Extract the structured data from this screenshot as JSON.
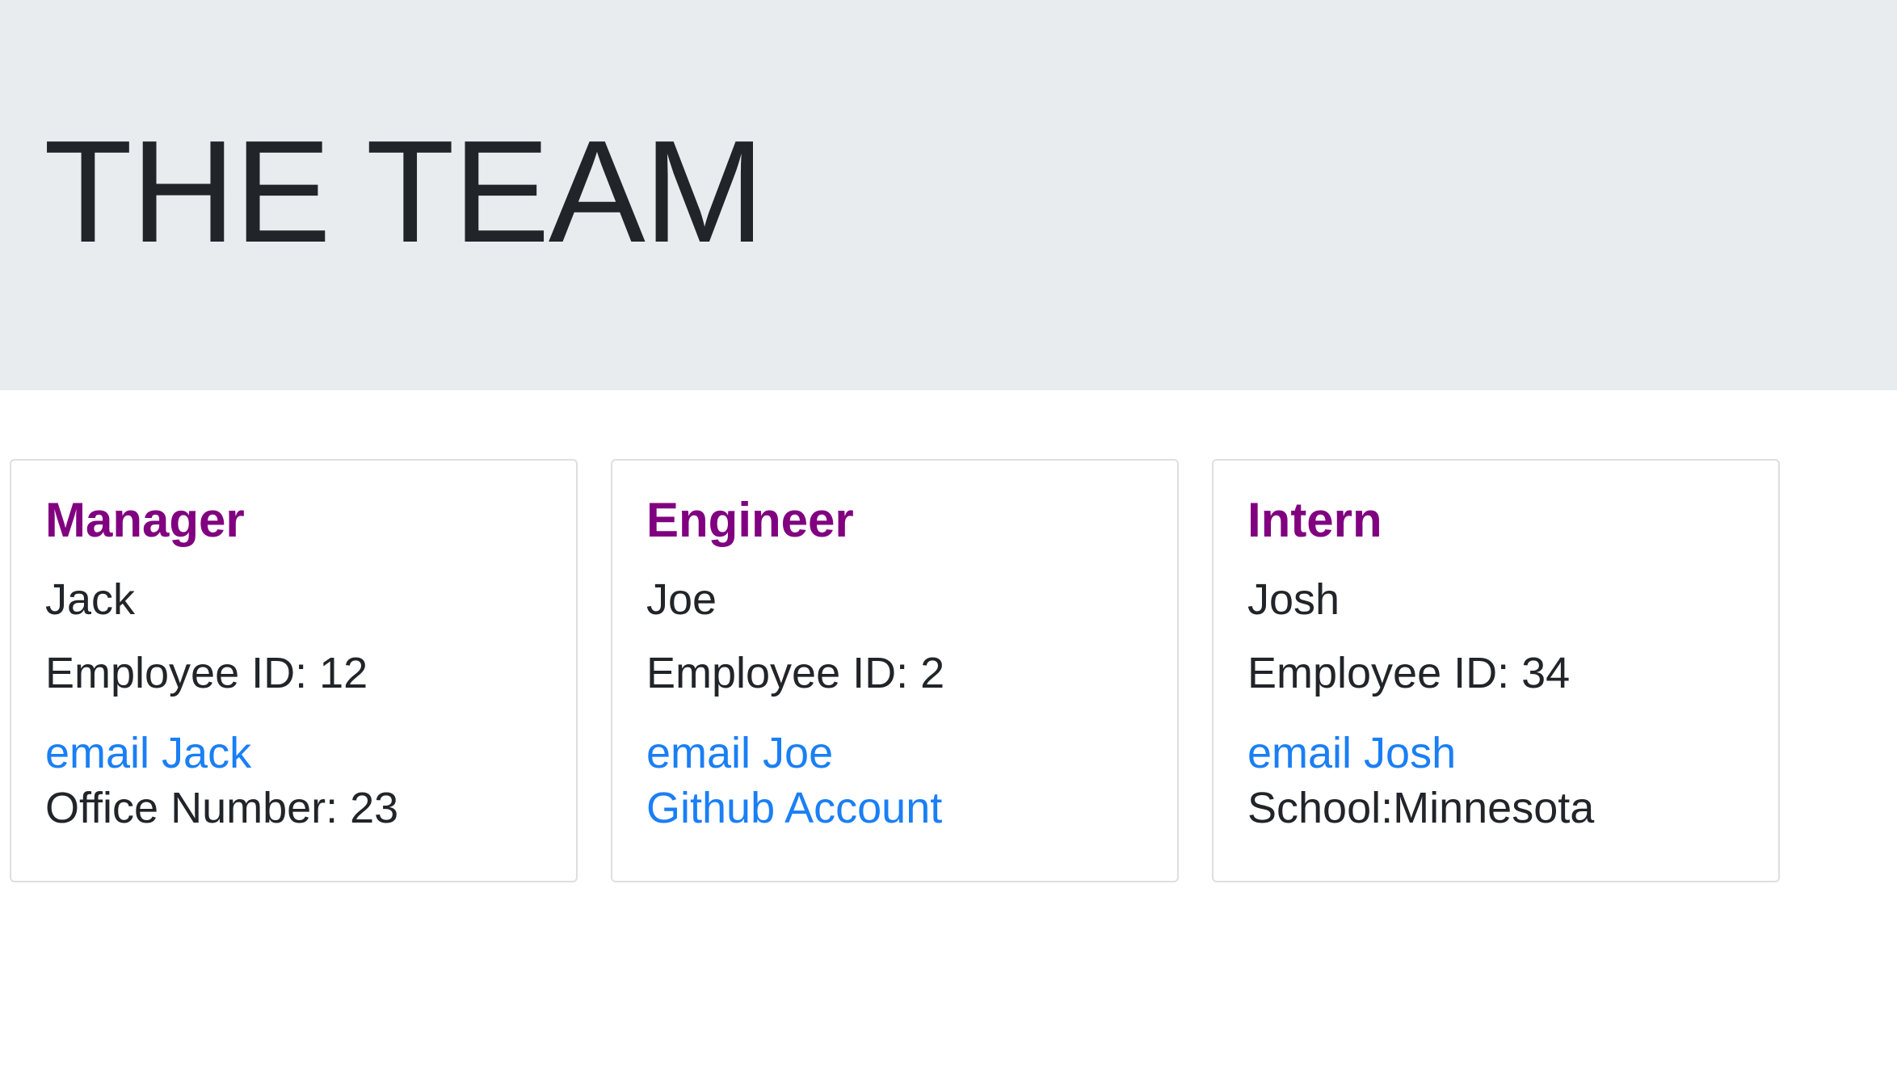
{
  "header": {
    "title": "THE TEAM"
  },
  "colors": {
    "header_bg": "#e9ecef",
    "role_color": "#800080",
    "link_color": "#1a7ff5",
    "text_color": "#212529"
  },
  "team": [
    {
      "role": "Manager",
      "name": "Jack",
      "employee_id": "Employee ID: 12",
      "email_label": "email Jack",
      "extra": "Office Number: 23"
    },
    {
      "role": "Engineer",
      "name": "Joe",
      "employee_id": "Employee ID: 2",
      "email_label": "email Joe",
      "extra": "Github Account"
    },
    {
      "role": "Intern",
      "name": "Josh",
      "employee_id": "Employee ID: 34",
      "email_label": "email Josh",
      "extra": "School:Minnesota"
    }
  ]
}
